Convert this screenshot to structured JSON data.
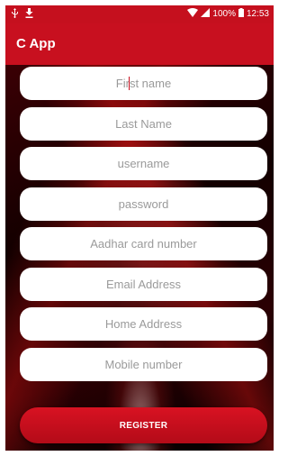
{
  "status_bar": {
    "battery": "100%",
    "time": "12:53",
    "icons": [
      "usb-icon",
      "download-icon",
      "wifi-icon",
      "signal-icon",
      "battery-icon"
    ]
  },
  "app_bar": {
    "title": "C App"
  },
  "form": {
    "first_name_placeholder": "First name",
    "last_name_placeholder": "Last Name",
    "username_placeholder": "username",
    "password_placeholder": "password",
    "aadhar_placeholder": "Aadhar card number",
    "email_placeholder": "Email Address",
    "home_address_placeholder": "Home Address",
    "mobile_placeholder": "Mobile number",
    "register_label": "REGISTER"
  },
  "colors": {
    "primary": "#c8101f",
    "field_bg": "#ffffff",
    "placeholder": "#9a9a9a"
  }
}
